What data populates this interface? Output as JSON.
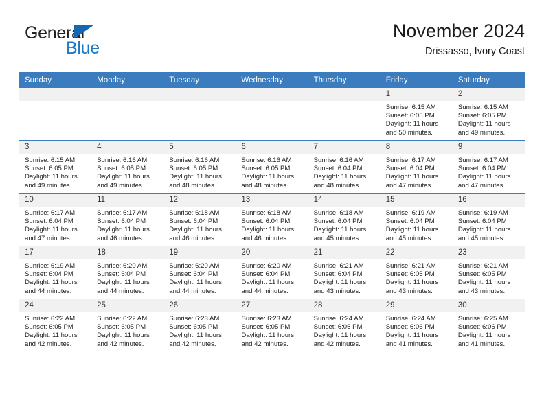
{
  "logo": {
    "word_top": "General",
    "word_bottom": "Blue",
    "triangle_color": "#1565b5",
    "blue_color": "#1b79c8"
  },
  "header": {
    "title": "November 2024",
    "subtitle": "Drissasso, Ivory Coast"
  },
  "theme": {
    "header_blue": "#3a7cbe",
    "daynum_band": "#f1f1f1",
    "text": "#212121"
  },
  "weekday_headers": [
    "Sunday",
    "Monday",
    "Tuesday",
    "Wednesday",
    "Thursday",
    "Friday",
    "Saturday"
  ],
  "weeks": [
    [
      {
        "day": "",
        "sunrise": "",
        "sunset": "",
        "daylight_line1": "",
        "daylight_line2": "",
        "empty": true
      },
      {
        "day": "",
        "sunrise": "",
        "sunset": "",
        "daylight_line1": "",
        "daylight_line2": "",
        "empty": true
      },
      {
        "day": "",
        "sunrise": "",
        "sunset": "",
        "daylight_line1": "",
        "daylight_line2": "",
        "empty": true
      },
      {
        "day": "",
        "sunrise": "",
        "sunset": "",
        "daylight_line1": "",
        "daylight_line2": "",
        "empty": true
      },
      {
        "day": "",
        "sunrise": "",
        "sunset": "",
        "daylight_line1": "",
        "daylight_line2": "",
        "empty": true
      },
      {
        "day": "1",
        "sunrise": "Sunrise: 6:15 AM",
        "sunset": "Sunset: 6:05 PM",
        "daylight_line1": "Daylight: 11 hours",
        "daylight_line2": "and 50 minutes."
      },
      {
        "day": "2",
        "sunrise": "Sunrise: 6:15 AM",
        "sunset": "Sunset: 6:05 PM",
        "daylight_line1": "Daylight: 11 hours",
        "daylight_line2": "and 49 minutes."
      }
    ],
    [
      {
        "day": "3",
        "sunrise": "Sunrise: 6:15 AM",
        "sunset": "Sunset: 6:05 PM",
        "daylight_line1": "Daylight: 11 hours",
        "daylight_line2": "and 49 minutes."
      },
      {
        "day": "4",
        "sunrise": "Sunrise: 6:16 AM",
        "sunset": "Sunset: 6:05 PM",
        "daylight_line1": "Daylight: 11 hours",
        "daylight_line2": "and 49 minutes."
      },
      {
        "day": "5",
        "sunrise": "Sunrise: 6:16 AM",
        "sunset": "Sunset: 6:05 PM",
        "daylight_line1": "Daylight: 11 hours",
        "daylight_line2": "and 48 minutes."
      },
      {
        "day": "6",
        "sunrise": "Sunrise: 6:16 AM",
        "sunset": "Sunset: 6:05 PM",
        "daylight_line1": "Daylight: 11 hours",
        "daylight_line2": "and 48 minutes."
      },
      {
        "day": "7",
        "sunrise": "Sunrise: 6:16 AM",
        "sunset": "Sunset: 6:04 PM",
        "daylight_line1": "Daylight: 11 hours",
        "daylight_line2": "and 48 minutes."
      },
      {
        "day": "8",
        "sunrise": "Sunrise: 6:17 AM",
        "sunset": "Sunset: 6:04 PM",
        "daylight_line1": "Daylight: 11 hours",
        "daylight_line2": "and 47 minutes."
      },
      {
        "day": "9",
        "sunrise": "Sunrise: 6:17 AM",
        "sunset": "Sunset: 6:04 PM",
        "daylight_line1": "Daylight: 11 hours",
        "daylight_line2": "and 47 minutes."
      }
    ],
    [
      {
        "day": "10",
        "sunrise": "Sunrise: 6:17 AM",
        "sunset": "Sunset: 6:04 PM",
        "daylight_line1": "Daylight: 11 hours",
        "daylight_line2": "and 47 minutes."
      },
      {
        "day": "11",
        "sunrise": "Sunrise: 6:17 AM",
        "sunset": "Sunset: 6:04 PM",
        "daylight_line1": "Daylight: 11 hours",
        "daylight_line2": "and 46 minutes."
      },
      {
        "day": "12",
        "sunrise": "Sunrise: 6:18 AM",
        "sunset": "Sunset: 6:04 PM",
        "daylight_line1": "Daylight: 11 hours",
        "daylight_line2": "and 46 minutes."
      },
      {
        "day": "13",
        "sunrise": "Sunrise: 6:18 AM",
        "sunset": "Sunset: 6:04 PM",
        "daylight_line1": "Daylight: 11 hours",
        "daylight_line2": "and 46 minutes."
      },
      {
        "day": "14",
        "sunrise": "Sunrise: 6:18 AM",
        "sunset": "Sunset: 6:04 PM",
        "daylight_line1": "Daylight: 11 hours",
        "daylight_line2": "and 45 minutes."
      },
      {
        "day": "15",
        "sunrise": "Sunrise: 6:19 AM",
        "sunset": "Sunset: 6:04 PM",
        "daylight_line1": "Daylight: 11 hours",
        "daylight_line2": "and 45 minutes."
      },
      {
        "day": "16",
        "sunrise": "Sunrise: 6:19 AM",
        "sunset": "Sunset: 6:04 PM",
        "daylight_line1": "Daylight: 11 hours",
        "daylight_line2": "and 45 minutes."
      }
    ],
    [
      {
        "day": "17",
        "sunrise": "Sunrise: 6:19 AM",
        "sunset": "Sunset: 6:04 PM",
        "daylight_line1": "Daylight: 11 hours",
        "daylight_line2": "and 44 minutes."
      },
      {
        "day": "18",
        "sunrise": "Sunrise: 6:20 AM",
        "sunset": "Sunset: 6:04 PM",
        "daylight_line1": "Daylight: 11 hours",
        "daylight_line2": "and 44 minutes."
      },
      {
        "day": "19",
        "sunrise": "Sunrise: 6:20 AM",
        "sunset": "Sunset: 6:04 PM",
        "daylight_line1": "Daylight: 11 hours",
        "daylight_line2": "and 44 minutes."
      },
      {
        "day": "20",
        "sunrise": "Sunrise: 6:20 AM",
        "sunset": "Sunset: 6:04 PM",
        "daylight_line1": "Daylight: 11 hours",
        "daylight_line2": "and 44 minutes."
      },
      {
        "day": "21",
        "sunrise": "Sunrise: 6:21 AM",
        "sunset": "Sunset: 6:04 PM",
        "daylight_line1": "Daylight: 11 hours",
        "daylight_line2": "and 43 minutes."
      },
      {
        "day": "22",
        "sunrise": "Sunrise: 6:21 AM",
        "sunset": "Sunset: 6:05 PM",
        "daylight_line1": "Daylight: 11 hours",
        "daylight_line2": "and 43 minutes."
      },
      {
        "day": "23",
        "sunrise": "Sunrise: 6:21 AM",
        "sunset": "Sunset: 6:05 PM",
        "daylight_line1": "Daylight: 11 hours",
        "daylight_line2": "and 43 minutes."
      }
    ],
    [
      {
        "day": "24",
        "sunrise": "Sunrise: 6:22 AM",
        "sunset": "Sunset: 6:05 PM",
        "daylight_line1": "Daylight: 11 hours",
        "daylight_line2": "and 42 minutes."
      },
      {
        "day": "25",
        "sunrise": "Sunrise: 6:22 AM",
        "sunset": "Sunset: 6:05 PM",
        "daylight_line1": "Daylight: 11 hours",
        "daylight_line2": "and 42 minutes."
      },
      {
        "day": "26",
        "sunrise": "Sunrise: 6:23 AM",
        "sunset": "Sunset: 6:05 PM",
        "daylight_line1": "Daylight: 11 hours",
        "daylight_line2": "and 42 minutes."
      },
      {
        "day": "27",
        "sunrise": "Sunrise: 6:23 AM",
        "sunset": "Sunset: 6:05 PM",
        "daylight_line1": "Daylight: 11 hours",
        "daylight_line2": "and 42 minutes."
      },
      {
        "day": "28",
        "sunrise": "Sunrise: 6:24 AM",
        "sunset": "Sunset: 6:06 PM",
        "daylight_line1": "Daylight: 11 hours",
        "daylight_line2": "and 42 minutes."
      },
      {
        "day": "29",
        "sunrise": "Sunrise: 6:24 AM",
        "sunset": "Sunset: 6:06 PM",
        "daylight_line1": "Daylight: 11 hours",
        "daylight_line2": "and 41 minutes."
      },
      {
        "day": "30",
        "sunrise": "Sunrise: 6:25 AM",
        "sunset": "Sunset: 6:06 PM",
        "daylight_line1": "Daylight: 11 hours",
        "daylight_line2": "and 41 minutes."
      }
    ]
  ]
}
